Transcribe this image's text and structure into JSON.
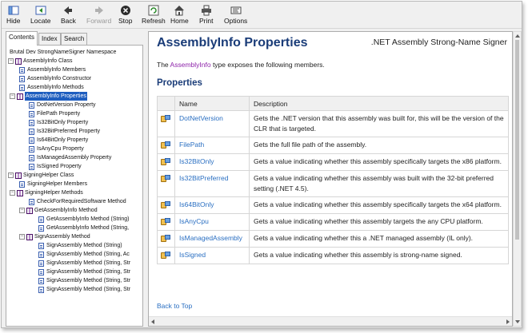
{
  "toolbar": {
    "hide": "Hide",
    "locate": "Locate",
    "back": "Back",
    "forward": "Forward",
    "stop": "Stop",
    "refresh": "Refresh",
    "home": "Home",
    "print": "Print",
    "options": "Options"
  },
  "nav": {
    "tabs": [
      "Contents",
      "Index",
      "Search"
    ],
    "tree": [
      {
        "label": "Brutal Dev StrongNameSigner Namespace"
      },
      {
        "label": "AssemblyInfo Class"
      },
      {
        "label": "AssemblyInfo Members"
      },
      {
        "label": "AssemblyInfo Constructor"
      },
      {
        "label": "AssemblyInfo Methods"
      },
      {
        "label": "AssemblyInfo Properties"
      },
      {
        "label": "DotNetVersion Property"
      },
      {
        "label": "FilePath Property"
      },
      {
        "label": "Is32BitOnly Property"
      },
      {
        "label": "Is32BitPreferred Property"
      },
      {
        "label": "Is64BitOnly Property"
      },
      {
        "label": "IsAnyCpu Property"
      },
      {
        "label": "IsManagedAssembly Property"
      },
      {
        "label": "IsSigned Property"
      },
      {
        "label": "SigningHelper Class"
      },
      {
        "label": "SigningHelper Members"
      },
      {
        "label": "SigningHelper Methods"
      },
      {
        "label": "CheckForRequiredSoftware Method"
      },
      {
        "label": "GetAssemblyInfo Method"
      },
      {
        "label": "GetAssemblyInfo Method (String)"
      },
      {
        "label": "GetAssemblyInfo Method (String,"
      },
      {
        "label": "SignAssembly Method"
      },
      {
        "label": "SignAssembly Method (String)"
      },
      {
        "label": "SignAssembly Method (String, Ac"
      },
      {
        "label": "SignAssembly Method (String, Str"
      },
      {
        "label": "SignAssembly Method (String, Str"
      },
      {
        "label": "SignAssembly Method (String, Str"
      },
      {
        "label": "SignAssembly Method (String, Str"
      }
    ]
  },
  "content": {
    "title": "AssemblyInfo Properties",
    "subtitle": ".NET Assembly Strong-Name Signer",
    "intro_prefix": "The ",
    "intro_link": "AssemblyInfo",
    "intro_suffix": " type exposes the following members.",
    "section": "Properties",
    "columns": [
      "Name",
      "Description"
    ],
    "rows": [
      {
        "name": "DotNetVersion",
        "description": "Gets the .NET version that this assembly was built for, this will be the version of the CLR that is targeted."
      },
      {
        "name": "FilePath",
        "description": "Gets the full file path of the assembly."
      },
      {
        "name": "Is32BitOnly",
        "description": "Gets a value indicating whether this assembly specifically targets the x86 platform."
      },
      {
        "name": "Is32BitPreferred",
        "description": "Gets a value indicating whether this assembly was built with the 32-bit preferred setting (.NET 4.5)."
      },
      {
        "name": "Is64BitOnly",
        "description": "Gets a value indicating whether this assembly specifically targets the x64 platform."
      },
      {
        "name": "IsAnyCpu",
        "description": "Gets a value indicating whether this assembly targets the any CPU platform."
      },
      {
        "name": "IsManagedAssembly",
        "description": "Gets a value indicating whether this a .NET managed assembly (IL only)."
      },
      {
        "name": "IsSigned",
        "description": "Gets a value indicating whether this assembly is strong-name signed."
      }
    ],
    "back_to_top": "Back to Top"
  },
  "colors": {
    "title": "#1a3c78",
    "link": "#2a6fc2",
    "intro_link": "#8e24aa",
    "selection": "#1e5ebf"
  },
  "icons": [
    "hide-icon",
    "locate-icon",
    "back-icon",
    "forward-icon",
    "stop-icon",
    "refresh-icon",
    "home-icon",
    "print-icon",
    "options-icon",
    "property-icon",
    "book-icon",
    "page-icon"
  ]
}
